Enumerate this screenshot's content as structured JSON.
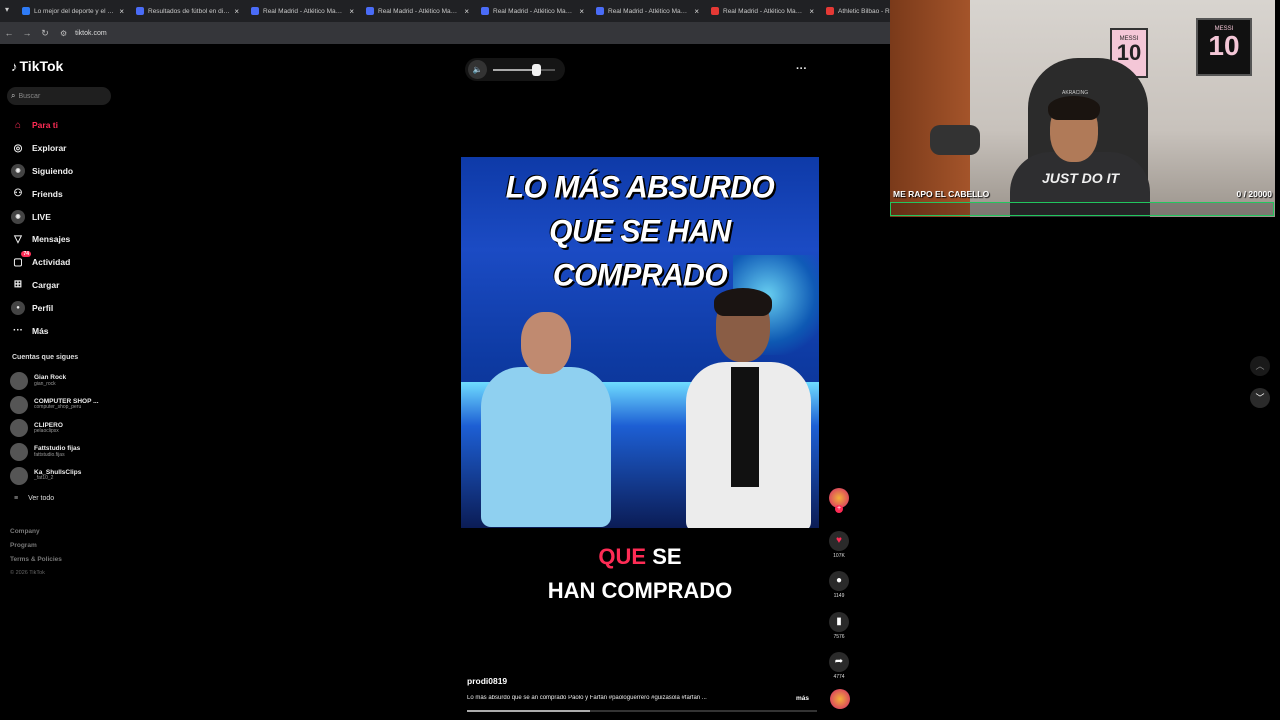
{
  "browser": {
    "tabs": [
      {
        "title": "Lo mejor del deporte y el entretenimiento",
        "color": "#2e7bf6"
      },
      {
        "title": "Resultados de fútbol en directo",
        "color": "#4a6cf7"
      },
      {
        "title": "Real Madrid - Atlético Madrid",
        "color": "#4a6cf7"
      },
      {
        "title": "Real Madrid - Atlético Madrid",
        "color": "#4a6cf7"
      },
      {
        "title": "Real Madrid - Atlético Madrid",
        "color": "#4a6cf7"
      },
      {
        "title": "Real Madrid - Atlético Madrid",
        "color": "#4a6cf7"
      },
      {
        "title": "Real Madrid - Atlético Madrid",
        "color": "#e53935"
      },
      {
        "title": "Athletic Bilbao - Real",
        "color": "#e53935"
      }
    ],
    "url": "tiktok.com"
  },
  "sidebar": {
    "logo": "TikTok",
    "search_placeholder": "Buscar",
    "nav": [
      {
        "label": "Para ti",
        "icon": "home-icon",
        "active": true
      },
      {
        "label": "Explorar",
        "icon": "compass-icon"
      },
      {
        "label": "Siguiendo",
        "icon": "following-icon"
      },
      {
        "label": "Friends",
        "icon": "friends-icon"
      },
      {
        "label": "LIVE",
        "icon": "live-icon"
      },
      {
        "label": "Mensajes",
        "icon": "messages-icon"
      },
      {
        "label": "Actividad",
        "icon": "activity-icon",
        "badge": "74"
      },
      {
        "label": "Cargar",
        "icon": "upload-icon"
      },
      {
        "label": "Perfil",
        "icon": "profile-icon"
      },
      {
        "label": "Más",
        "icon": "more-icon"
      }
    ],
    "following_title": "Cuentas que sigues",
    "following": [
      {
        "name": "Gian Rock",
        "handle": "gian_rock"
      },
      {
        "name": "COMPUTER SHOP ...",
        "handle": "computer_shop_peru"
      },
      {
        "name": "CLIPERO",
        "handle": "pelaoclipsx"
      },
      {
        "name": "Fattstudio fijas",
        "handle": "fattstudio.fijas"
      },
      {
        "name": "Ka_ShullsClips",
        "handle": "_fat10_2"
      }
    ],
    "see_all": "Ver todo",
    "footer": [
      "Company",
      "Program",
      "Terms & Policies"
    ],
    "copyright": "© 2026 TikTok"
  },
  "player": {
    "volume": 0.7,
    "video_title_line1": "LO MÁS ABSURDO",
    "video_title_line2": "QUE SE HAN COMPRADO",
    "caption_highlight": "QUE",
    "caption_rest": " SE",
    "caption_line2": "HAN COMPRADO",
    "likes": "107K",
    "comments": "1149",
    "saves": "7576",
    "shares": "4774",
    "author": "prodi0819",
    "description": "Lo más absurdo que se an comprado Paolo y Farfán #paologuerrero #guizasola #farfan ...",
    "more_label": "más",
    "progress": 0.35
  },
  "webcam": {
    "frame1_label": "MESSI",
    "frame1_num": "10",
    "frame2_label": "MESSI",
    "frame2_num": "10",
    "chair_brand": "AKRACING",
    "shirt_text": "JUST DO IT",
    "goal_label": "ME RAPO EL CABELLO",
    "goal_progress": "0  / 20000"
  }
}
